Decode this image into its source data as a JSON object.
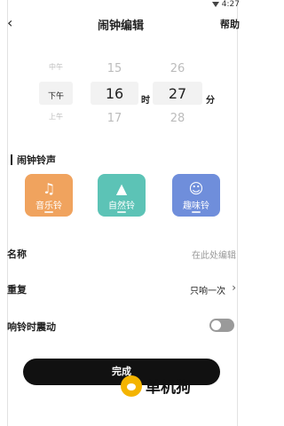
{
  "status": {
    "time": "4:27"
  },
  "header": {
    "back_icon": "back-chevron",
    "title": "闹钟编辑",
    "help": "帮助"
  },
  "picker": {
    "ampm": [
      "中午",
      "下午",
      "上午"
    ],
    "hours": [
      "15",
      "16",
      "17"
    ],
    "minutes": [
      "26",
      "27",
      "28"
    ],
    "hour_unit": "时",
    "minute_unit": "分"
  },
  "ringtone_section": {
    "title": "闹钟铃声",
    "tiles": [
      {
        "label": "音乐铃",
        "icon": "music-note-icon",
        "color": "#f0a35e"
      },
      {
        "label": "自然铃",
        "icon": "landscape-icon",
        "color": "#5cc3b6"
      },
      {
        "label": "趣味铃",
        "icon": "smiley-icon",
        "color": "#6f8edb"
      }
    ]
  },
  "fields": {
    "name_label": "名称",
    "name_placeholder": "在此处编辑",
    "repeat_label": "重复",
    "repeat_value": "只响一次",
    "vibrate_label": "响铃时震动"
  },
  "buttons": {
    "done": "完成"
  },
  "watermark": {
    "text": "单机狗"
  }
}
